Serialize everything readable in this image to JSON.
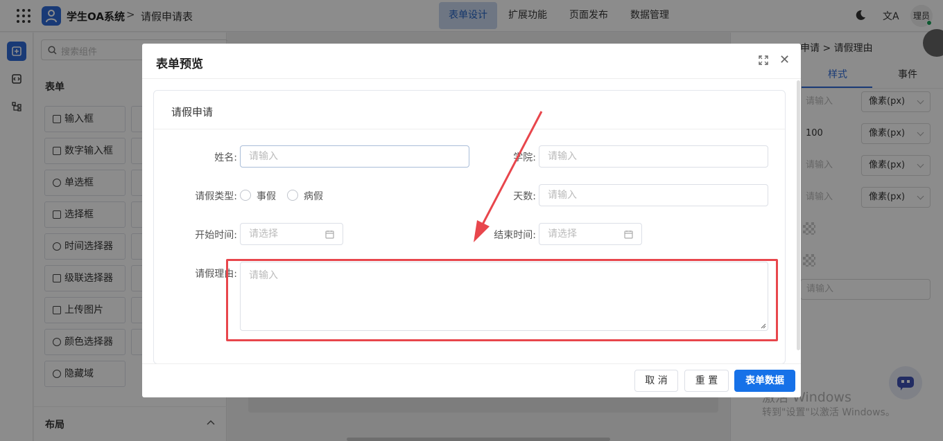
{
  "header": {
    "app_title": "学生OA系统",
    "breadcrumb_sep": ">",
    "page_title": "请假申请表",
    "tabs": [
      {
        "label": "表单设计",
        "active": true
      },
      {
        "label": "扩展功能",
        "active": false
      },
      {
        "label": "页面发布",
        "active": false
      },
      {
        "label": "数据管理",
        "active": false
      }
    ],
    "translate_icon": "文A",
    "avatar_label": "理员",
    "icons": [
      "apps-grid-icon",
      "user-logo-icon",
      "moon-icon",
      "translate-icon"
    ]
  },
  "sidebar": {
    "search_placeholder": "搜索组件",
    "section_form": "表单",
    "components": [
      "输入框",
      "数字输入框",
      "单选框",
      "选择框",
      "时间选择器",
      "级联选择器",
      "上传图片",
      "颜色选择器",
      "隐藏域"
    ],
    "section_layout": "布局"
  },
  "properties": {
    "breadcrumb": "申请 > 请假理由",
    "tabs": [
      "样式",
      "事件"
    ],
    "active_tab": "样式",
    "rows": [
      {
        "input": "请输入",
        "unit": "像素(px)"
      },
      {
        "input": "100",
        "unit": "像素(px)"
      },
      {
        "input": "请输入",
        "unit": "像素(px)"
      },
      {
        "input": "请输入",
        "unit": "像素(px)"
      }
    ],
    "extra_input": "请输入"
  },
  "modal": {
    "title": "表单预览",
    "card_title": "请假申请",
    "fields": {
      "name_label": "姓名:",
      "name_placeholder": "请输入",
      "college_label": "学院:",
      "college_placeholder": "请输入",
      "type_label": "请假类型:",
      "type_options": [
        "事假",
        "病假"
      ],
      "days_label": "天数:",
      "days_placeholder": "请输入",
      "start_label": "开始时间:",
      "start_placeholder": "请选择",
      "end_label": "结束时间:",
      "end_placeholder": "请选择",
      "reason_label": "请假理由:",
      "reason_placeholder": "请输入"
    },
    "buttons": {
      "cancel": "取 消",
      "reset": "重 置",
      "submit": "表单数据"
    }
  },
  "watermark": {
    "line1": "激活 Windows",
    "line2": "转到\"设置\"以激活 Windows。"
  },
  "colors": {
    "primary": "#1671e8",
    "annotation": "#e8464c",
    "active_tab_bg": "#c9d8ee"
  }
}
